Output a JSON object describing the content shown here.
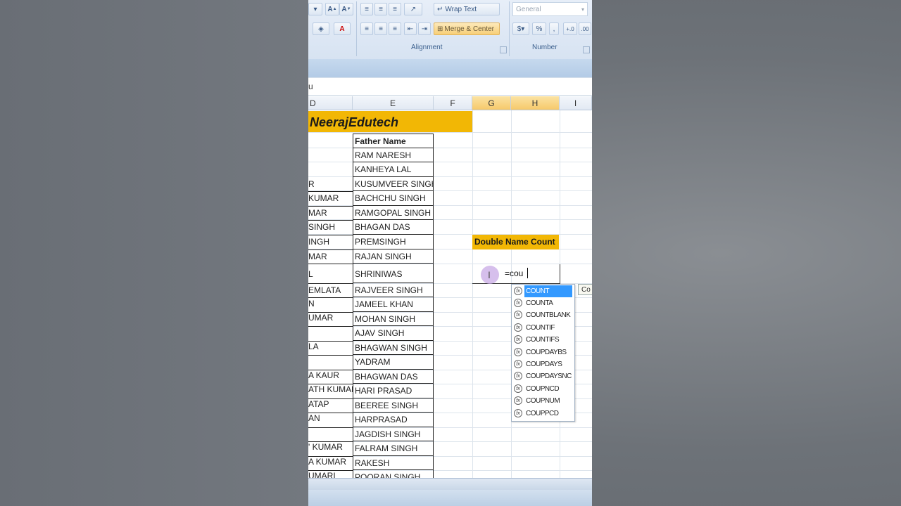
{
  "ribbon": {
    "wrap_text": "Wrap Text",
    "merge_center": "Merge & Center",
    "number_format": "General",
    "currency": "$",
    "percent": "%",
    "comma": ",",
    "alignment_label": "Alignment",
    "number_label": "Number"
  },
  "formula_bar": {
    "fragment": "u"
  },
  "columns": [
    "D",
    "E",
    "F",
    "G",
    "H",
    "I"
  ],
  "sheet": {
    "title": "NeerajEdutech",
    "header_e": "Father Name",
    "rows": [
      {
        "d": "",
        "e": "RAM NARESH"
      },
      {
        "d": "",
        "e": "KANHEYA LAL"
      },
      {
        "d": "R",
        "e": "KUSUMVEER SINGH"
      },
      {
        "d": "KUMAR",
        "e": "BACHCHU SINGH"
      },
      {
        "d": "MAR",
        "e": "RAMGOPAL SINGH"
      },
      {
        "d": " SINGH",
        "e": "BHAGAN DAS"
      },
      {
        "d": "INGH",
        "e": "PREMSINGH"
      },
      {
        "d": "MAR",
        "e": "RAJAN SINGH"
      },
      {
        "d": "L",
        "e": "SHRINIWAS"
      },
      {
        "d": "EMLATA",
        "e": "RAJVEER SINGH"
      },
      {
        "d": "N",
        "e": "JAMEEL KHAN"
      },
      {
        "d": "UMAR",
        "e": "MOHAN SINGH"
      },
      {
        "d": "",
        "e": "AJAV SINGH"
      },
      {
        "d": "LA",
        "e": "BHAGWAN SINGH"
      },
      {
        "d": "",
        "e": "YADRAM"
      },
      {
        "d": "A KAUR",
        "e": "BHAGWAN DAS"
      },
      {
        "d": "ATH KUMAR",
        "e": "HARI PRASAD"
      },
      {
        "d": "ATAP",
        "e": "BEEREE SINGH"
      },
      {
        "d": "AN",
        "e": "HARPRASAD"
      },
      {
        "d": "",
        "e": "JAGDISH SINGH"
      },
      {
        "d": "' KUMAR",
        "e": "FALRAM SINGH"
      },
      {
        "d": "A KUMAR",
        "e": "RAKESH"
      },
      {
        "d": "UMARI",
        "e": "POORAN SINGH"
      }
    ],
    "double_name_label": "Double Name Count",
    "edit_value": "=cou"
  },
  "autocomplete": {
    "items": [
      "COUNT",
      "COUNTA",
      "COUNTBLANK",
      "COUNTIF",
      "COUNTIFS",
      "COUPDAYBS",
      "COUPDAYS",
      "COUPDAYSNC",
      "COUPNCD",
      "COUPNUM",
      "COUPPCD"
    ],
    "selected_index": 0,
    "fx_icon": "fx",
    "tooltip": "Co"
  },
  "colors": {
    "accent_yellow": "#f2b705",
    "selected_header": "#f6c96a",
    "selection_blue": "#3399ff"
  }
}
